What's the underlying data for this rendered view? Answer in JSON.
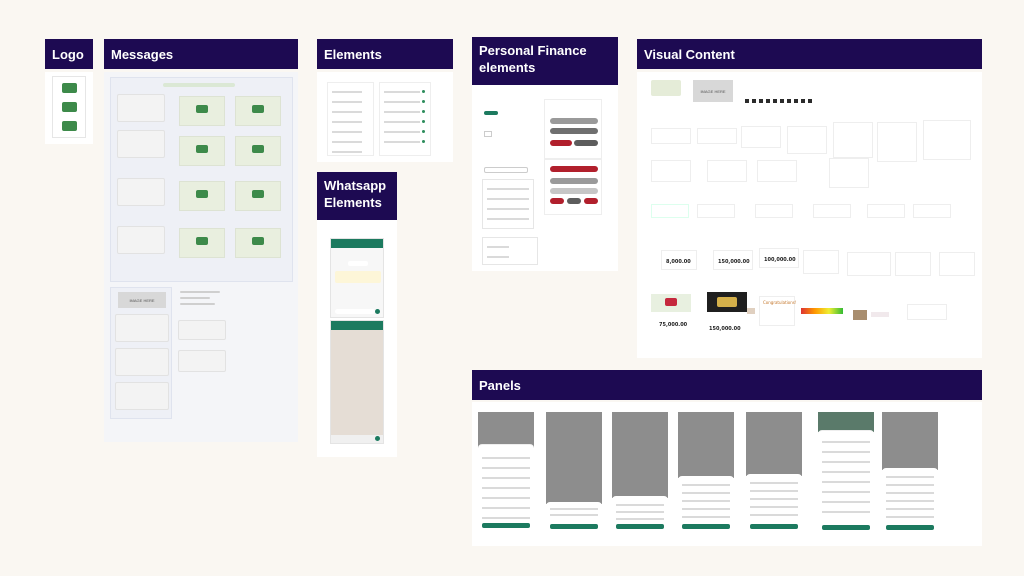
{
  "headers": {
    "logo": "Logo",
    "messages": "Messages",
    "elements": "Elements",
    "personal_finance": "Personal Finance elements",
    "visual_content": "Visual Content",
    "whatsapp": "Whatsapp Elements",
    "panels": "Panels"
  },
  "placeholders": {
    "image_here_messages": "IMAGE HERE",
    "image_here_visual": "IMAGE HERE"
  },
  "visual_content": {
    "amounts": [
      "8,000.00",
      "150,000.00",
      "100,000.00",
      "75,000.00",
      "150,000.00"
    ],
    "congrats": "Congratulations!"
  },
  "colors": {
    "header_bg": "#1d0a52",
    "page_bg": "#faf7f2",
    "accent_green": "#1c7a5f",
    "danger_red": "#b11f2c"
  }
}
